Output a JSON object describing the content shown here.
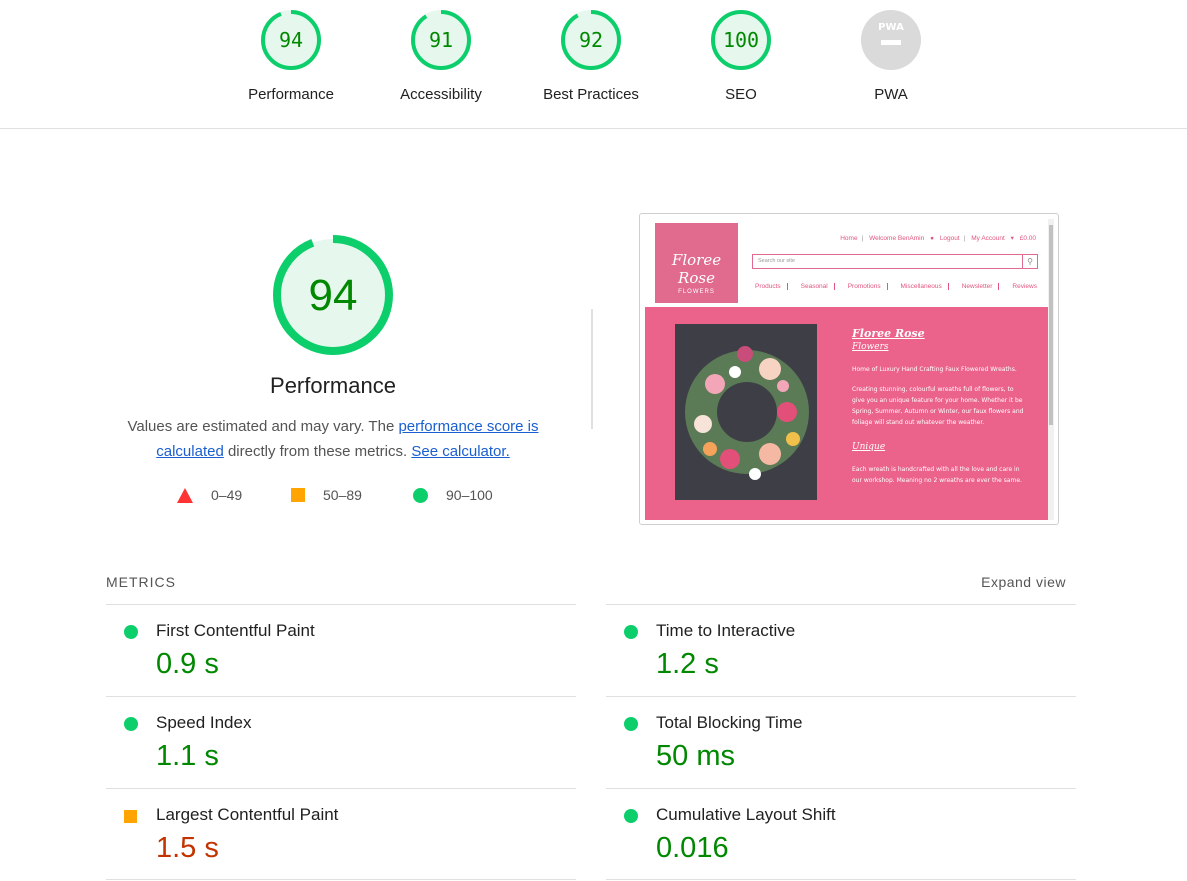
{
  "summary": {
    "gauges": [
      {
        "score": "94",
        "label": "Performance",
        "status": "pass"
      },
      {
        "score": "91",
        "label": "Accessibility",
        "status": "pass"
      },
      {
        "score": "92",
        "label": "Best Practices",
        "status": "pass"
      },
      {
        "score": "100",
        "label": "SEO",
        "status": "pass"
      },
      {
        "score": "PWA",
        "label": "PWA",
        "status": "na"
      }
    ]
  },
  "performance": {
    "score": "94",
    "title": "Performance",
    "desc_prefix": "Values are estimated and may vary. The ",
    "link_score": "performance score is calculated",
    "desc_middle": " directly from these metrics. ",
    "link_calculator": "See calculator.",
    "legend": [
      {
        "shape": "triangle",
        "range": "0–49",
        "color": "#ff3333"
      },
      {
        "shape": "square",
        "range": "50–89",
        "color": "#ffa400"
      },
      {
        "shape": "circle",
        "range": "90–100",
        "color": "#0cce6b"
      }
    ]
  },
  "screenshot": {
    "logo_line1": "Floree Rose",
    "logo_line2": "FLOWERS",
    "top_nav": [
      "Home",
      "Welcome BenAmin",
      "Logout",
      "My Account",
      "£0.00"
    ],
    "search_placeholder": "Search our site",
    "categories": [
      "Products",
      "Seasonal",
      "Promotions",
      "Miscellaneous",
      "Newsletter",
      "Reviews"
    ],
    "hero_title": "Floree Rose",
    "hero_subtitle": "Flowers",
    "hero_p1": "Home of Luxury Hand Crafting Faux Flowered Wreaths.",
    "hero_p2": "Creating stunning, colourful wreaths full of flowers, to give you an unique feature for your home. Whether it be Spring, Summer, Autumn or Winter, our faux flowers and foliage will stand out whatever the weather.",
    "hero_h3": "Unique",
    "hero_p3": "Each wreath is handcrafted with all the love and care in our workshop. Meaning no 2 wreaths are ever the same."
  },
  "metrics": {
    "heading": "METRICS",
    "expand_label": "Expand view",
    "items": [
      {
        "title": "First Contentful Paint",
        "value": "0.9 s",
        "status": "pass"
      },
      {
        "title": "Time to Interactive",
        "value": "1.2 s",
        "status": "pass"
      },
      {
        "title": "Speed Index",
        "value": "1.1 s",
        "status": "pass"
      },
      {
        "title": "Total Blocking Time",
        "value": "50 ms",
        "status": "pass"
      },
      {
        "title": "Largest Contentful Paint",
        "value": "1.5 s",
        "status": "average"
      },
      {
        "title": "Cumulative Layout Shift",
        "value": "0.016",
        "status": "pass"
      }
    ]
  },
  "colors": {
    "pass": "#0cce6b",
    "pass_text": "#008800",
    "average": "#ffa400",
    "average_text": "#c33300",
    "fail": "#ff3333",
    "link": "#1a5fd0",
    "site_pink": "#eb628b"
  }
}
